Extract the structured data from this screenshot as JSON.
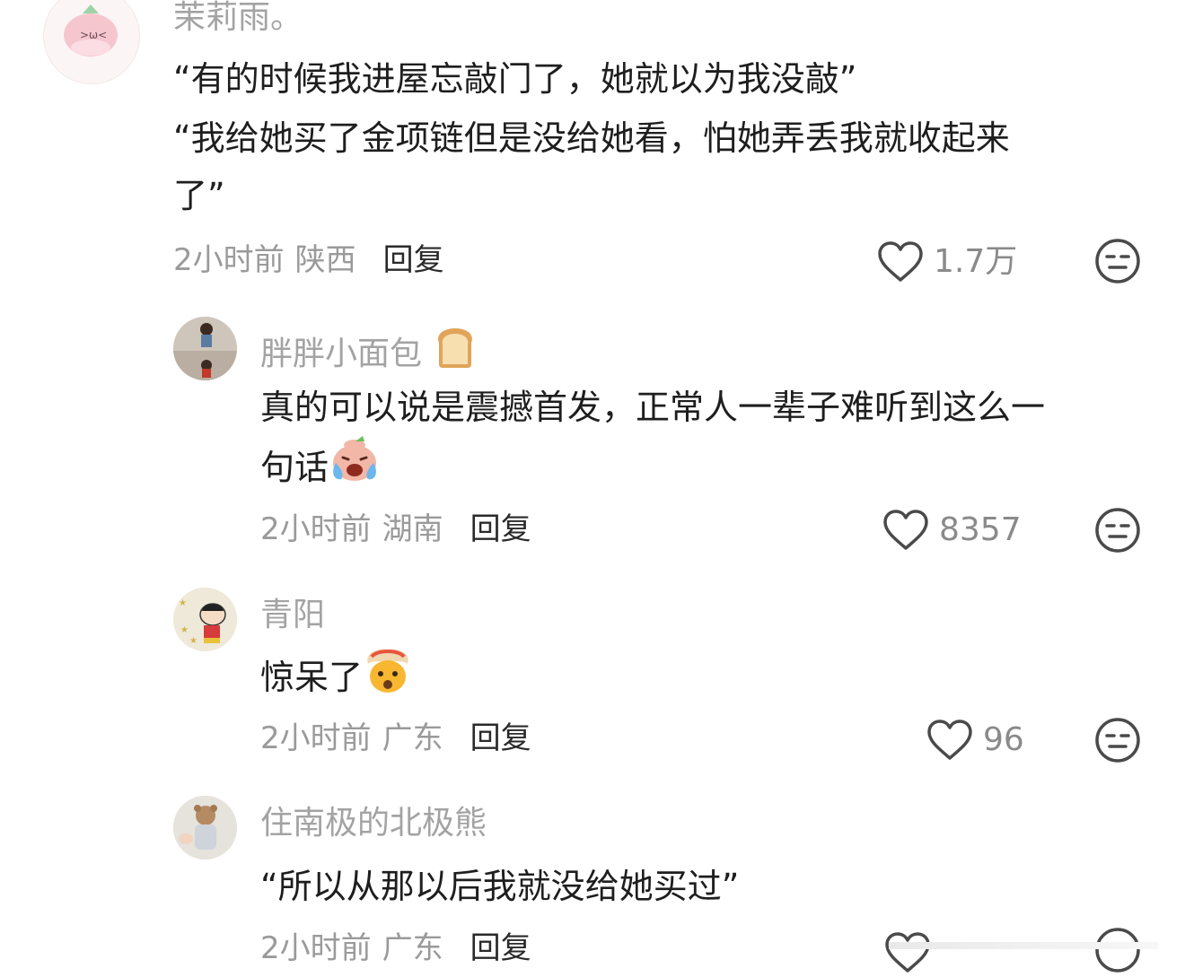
{
  "comments": [
    {
      "username": "茉莉雨。",
      "lines": [
        "“有的时候我进屋忘敲门了，她就以为我没敲”",
        "“我给她买了金项链但是没给她看，怕她弄丢我就收起来",
        "了”"
      ],
      "time": "2小时前",
      "location": "陕西",
      "reply_label": "回复",
      "likes": "1.7万"
    },
    {
      "username": "胖胖小面包",
      "lines": [
        "真的可以说是震撼首发，正常人一辈子难听到这么一",
        "句话"
      ],
      "time": "2小时前",
      "location": "湖南",
      "reply_label": "回复",
      "likes": "8357"
    },
    {
      "username": "青阳",
      "lines": [
        "惊呆了"
      ],
      "time": "2小时前",
      "location": "广东",
      "reply_label": "回复",
      "likes": "96"
    },
    {
      "username": "住南极的北极熊",
      "lines": [
        "“所以从那以后我就没给她买过”"
      ],
      "time": "2小时前",
      "location": "广东",
      "reply_label": "回复",
      "likes": ""
    }
  ],
  "icons": {
    "like": "heart-outline-icon",
    "dislike": "meh-face-icon",
    "bread_emoji": "bread-emoji",
    "crying_emoji": "crying-face-emoji",
    "exploding_emoji": "exploding-head-emoji"
  },
  "colors": {
    "username": "#a3a3a3",
    "meta": "#9a9a9a",
    "text": "#1e1e1e",
    "icon": "#4a4a4a"
  }
}
